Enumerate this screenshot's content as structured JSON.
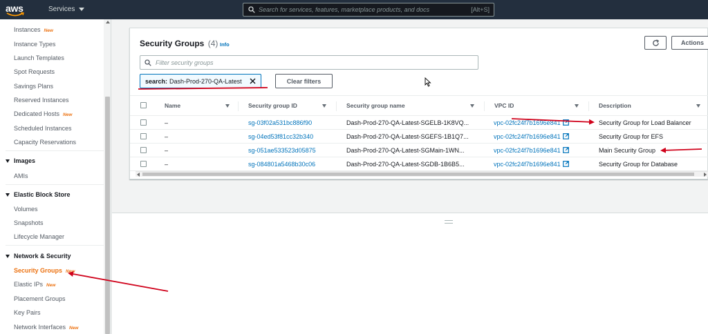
{
  "colors": {
    "nav_bg": "#232f3e",
    "accent": "#ec7211",
    "link": "#0073bb",
    "annotation": "#d0021b"
  },
  "topnav": {
    "logo": "aws",
    "services_label": "Services",
    "search_placeholder": "Search for services, features, marketplace products, and docs",
    "search_shortcut": "[Alt+S]"
  },
  "sidebar": {
    "items_top": [
      {
        "label": "Instances",
        "new": "New"
      },
      {
        "label": "Instance Types"
      },
      {
        "label": "Launch Templates"
      },
      {
        "label": "Spot Requests"
      },
      {
        "label": "Savings Plans"
      },
      {
        "label": "Reserved Instances"
      },
      {
        "label": "Dedicated Hosts",
        "new": "New"
      },
      {
        "label": "Scheduled Instances"
      },
      {
        "label": "Capacity Reservations"
      }
    ],
    "images_header": "Images",
    "images_items": [
      {
        "label": "AMIs"
      }
    ],
    "ebs_header": "Elastic Block Store",
    "ebs_items": [
      {
        "label": "Volumes"
      },
      {
        "label": "Snapshots"
      },
      {
        "label": "Lifecycle Manager"
      }
    ],
    "net_header": "Network & Security",
    "net_items": [
      {
        "label": "Security Groups",
        "new": "New"
      },
      {
        "label": "Elastic IPs",
        "new": "New"
      },
      {
        "label": "Placement Groups"
      },
      {
        "label": "Key Pairs"
      },
      {
        "label": "Network Interfaces",
        "new": "New"
      }
    ]
  },
  "panel": {
    "title": "Security Groups",
    "count": "(4)",
    "info": "Info",
    "actions_label": "Actions",
    "filter_placeholder": "Filter security groups",
    "token_key": "search:",
    "token_value": "Dash-Prod-270-QA-Latest",
    "clear_filters": "Clear filters"
  },
  "table": {
    "columns": [
      "Name",
      "Security group ID",
      "Security group name",
      "VPC ID",
      "Description"
    ],
    "rows": [
      {
        "name": "–",
        "id": "sg-03f02a531bc886f90",
        "group_name": "Dash-Prod-270-QA-Latest-SGELB-1K8VQ...",
        "vpc": "vpc-02fc24f7b1696e841",
        "description": "Security Group for Load Balancer"
      },
      {
        "name": "–",
        "id": "sg-04ed53f81cc32b340",
        "group_name": "Dash-Prod-270-QA-Latest-SGEFS-1B1Q7...",
        "vpc": "vpc-02fc24f7b1696e841",
        "description": "Security Group for EFS"
      },
      {
        "name": "–",
        "id": "sg-051ae533523d05875",
        "group_name": "Dash-Prod-270-QA-Latest-SGMain-1WN...",
        "vpc": "vpc-02fc24f7b1696e841",
        "description": "Main Security Group"
      },
      {
        "name": "–",
        "id": "sg-084801a5468b30c06",
        "group_name": "Dash-Prod-270-QA-Latest-SGDB-1B6B5...",
        "vpc": "vpc-02fc24f7b1696e841",
        "description": "Security Group for Database"
      }
    ]
  }
}
